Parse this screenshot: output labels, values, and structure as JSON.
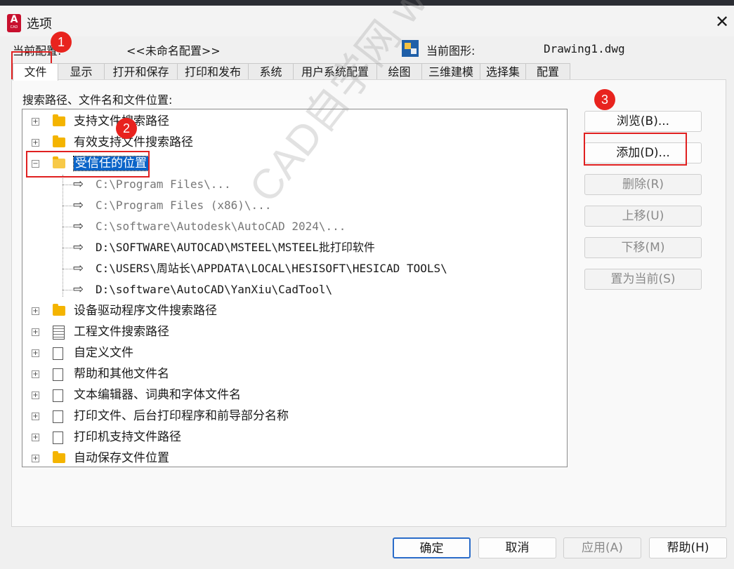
{
  "window": {
    "title": "选项",
    "app_icon_label": "A",
    "app_icon_sub": "CAD",
    "close_label": "✕"
  },
  "profile": {
    "current_profile_label": "当前配置:",
    "current_profile_value": "<<未命名配置>>",
    "current_drawing_label": "当前图形:",
    "current_drawing_value": "Drawing1.dwg"
  },
  "tabs": [
    {
      "label": "文件",
      "active": true
    },
    {
      "label": "显示"
    },
    {
      "label": "打开和保存"
    },
    {
      "label": "打印和发布"
    },
    {
      "label": "系统"
    },
    {
      "label": "用户系统配置"
    },
    {
      "label": "绘图"
    },
    {
      "label": "三维建模"
    },
    {
      "label": "选择集"
    },
    {
      "label": "配置"
    }
  ],
  "files_tab": {
    "section_label": "搜索路径、文件名和文件位置:",
    "tree": [
      {
        "label": "支持文件搜索路径",
        "icon": "folder-icon",
        "expander": "+"
      },
      {
        "label": "有效支持文件搜索路径",
        "icon": "folder-icon",
        "expander": "+"
      },
      {
        "label": "受信任的位置",
        "icon": "open-folder-icon",
        "expander": "−",
        "selected": true
      },
      {
        "label": "C:\\Program Files\\...",
        "child": true,
        "dimmed": true
      },
      {
        "label": "C:\\Program Files (x86)\\...",
        "child": true,
        "dimmed": true
      },
      {
        "label": "C:\\software\\Autodesk\\AutoCAD 2024\\...",
        "child": true,
        "dimmed": true
      },
      {
        "label": "D:\\SOFTWARE\\AUTOCAD\\MSTEEL\\MSTEEL批打印软件",
        "child": true
      },
      {
        "label": "C:\\USERS\\周站长\\APPDATA\\LOCAL\\HESISOFT\\HESICAD TOOLS\\",
        "child": true
      },
      {
        "label": "D:\\software\\AutoCAD\\YanXiu\\CadTool\\",
        "child": true
      },
      {
        "label": "设备驱动程序文件搜索路径",
        "icon": "folder-icon",
        "expander": "+"
      },
      {
        "label": "工程文件搜索路径",
        "icon": "document-list-icon",
        "expander": "+"
      },
      {
        "label": "自定义文件",
        "icon": "documents-icon",
        "expander": "+"
      },
      {
        "label": "帮助和其他文件名",
        "icon": "documents-icon",
        "expander": "+"
      },
      {
        "label": "文本编辑器、词典和字体文件名",
        "icon": "documents-icon",
        "expander": "+"
      },
      {
        "label": "打印文件、后台打印程序和前导部分名称",
        "icon": "documents-icon",
        "expander": "+"
      },
      {
        "label": "打印机支持文件路径",
        "icon": "documents-icon",
        "expander": "+"
      },
      {
        "label": "自动保存文件位置",
        "icon": "folder-icon",
        "expander": "+"
      }
    ]
  },
  "side_buttons": {
    "browse": "浏览(B)...",
    "add": "添加(D)...",
    "remove": "删除(R)",
    "move_up": "上移(U)",
    "move_down": "下移(M)",
    "set_current": "置为当前(S)"
  },
  "bottom_buttons": {
    "ok": "确定",
    "cancel": "取消",
    "apply": "应用(A)",
    "help": "帮助(H)"
  },
  "annotations": {
    "badge_1": "1",
    "badge_2": "2",
    "badge_3": "3",
    "highlight_color": "#e02020"
  },
  "watermark": "CAD自学网 www.cadzxw.com"
}
